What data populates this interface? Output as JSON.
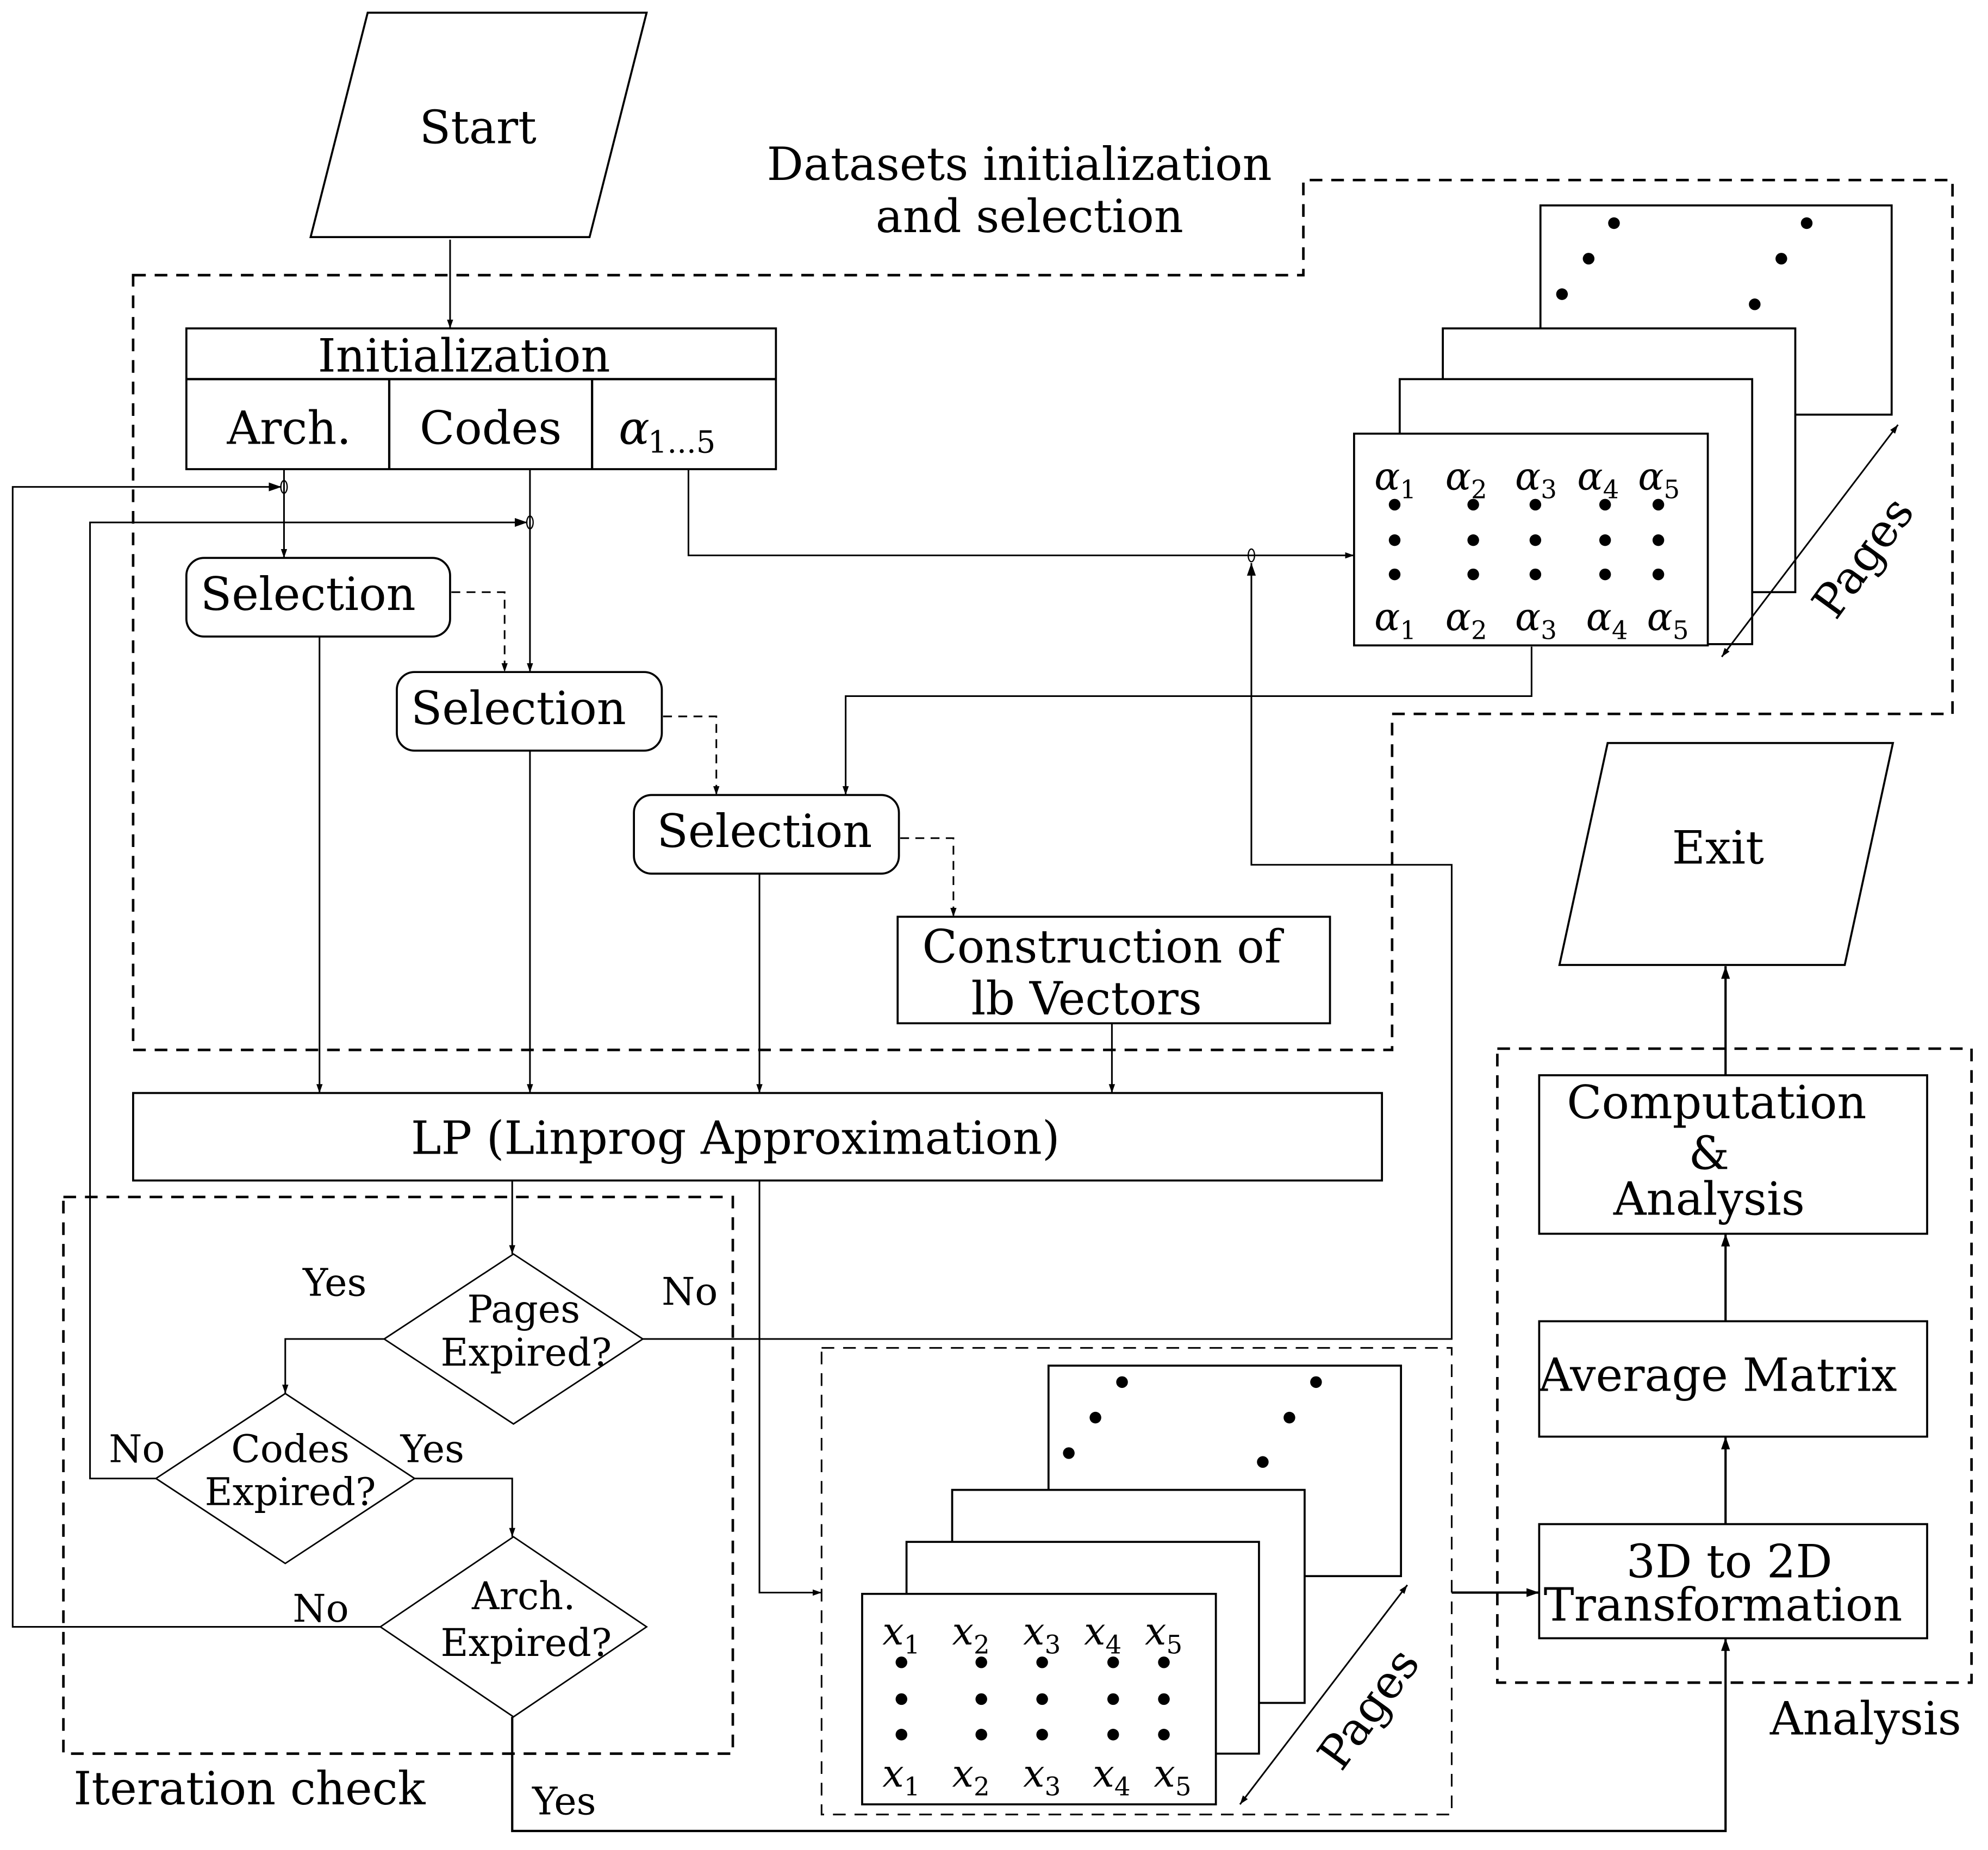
{
  "diagram": {
    "start_label": "Start",
    "exit_label": "Exit",
    "group_datasets": {
      "title_line1": "Datasets initialization",
      "title_line2": "and selection"
    },
    "initialization": {
      "header": "Initialization",
      "columns": [
        {
          "label": "Arch."
        },
        {
          "label": "Codes"
        },
        {
          "label_base": "α",
          "label_sub": "1...5"
        }
      ]
    },
    "selections": [
      {
        "label": "Selection"
      },
      {
        "label": "Selection"
      },
      {
        "label": "Selection"
      }
    ],
    "construction": {
      "line1": "Construction of",
      "line2": "lb Vectors"
    },
    "lp_box": "LP (Linprog Approximation)",
    "iteration_check": {
      "title": "Iteration check",
      "pages_diamond": {
        "line1": "Pages",
        "line2": "Expired?"
      },
      "codes_diamond": {
        "line1": "Codes",
        "line2": "Expired?"
      },
      "arch_diamond": {
        "line1": "Arch.",
        "line2": "Expired?"
      },
      "pages_yes": "Yes",
      "pages_no": "No",
      "codes_no": "No",
      "codes_yes": "Yes",
      "arch_no": "No",
      "arch_yes": "Yes"
    },
    "alpha_pages": {
      "axis_label": "Pages",
      "symbol": "α",
      "top_labels": [
        "1",
        "2",
        "3",
        "4",
        "5"
      ],
      "bottom_labels": [
        "1",
        "2",
        "3",
        "4",
        "5"
      ],
      "dot_rows": 3,
      "page_count_visible": 4
    },
    "x_pages": {
      "axis_label": "Pages",
      "symbol": "x",
      "top_labels": [
        "1",
        "2",
        "3",
        "4",
        "5"
      ],
      "bottom_labels": [
        "1",
        "2",
        "3",
        "4",
        "5"
      ],
      "dot_rows": 3,
      "page_count_visible": 4
    },
    "analysis": {
      "title": "Analysis",
      "transform": {
        "line1": "3D to 2D",
        "line2": "Transformation"
      },
      "average": "Average Matrix",
      "computation": {
        "line1": "Computation",
        "line2": "&",
        "line3": "Analysis"
      }
    }
  }
}
